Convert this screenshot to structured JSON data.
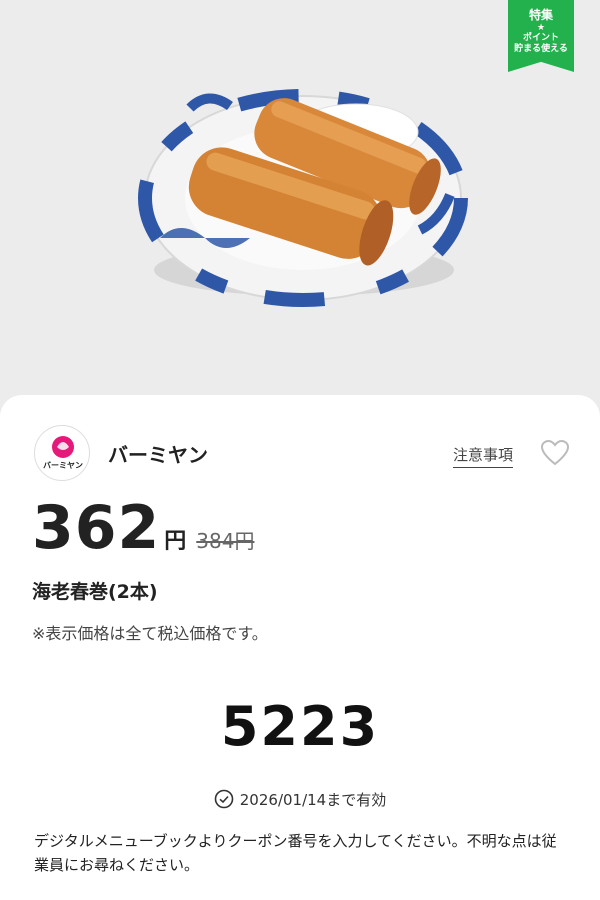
{
  "badge": {
    "line1": "特集",
    "star": "★",
    "line2": "ポイント",
    "line3": "貯まる使える"
  },
  "shop": {
    "name": "バーミヤン",
    "logo_text": "バーミヤン"
  },
  "notes_link": "注意事項",
  "price": {
    "current": "362",
    "unit": "円",
    "original": "384円"
  },
  "item_name": "海老春巻(2本)",
  "tax_note": "※表示価格は全て税込価格です。",
  "coupon_code": "5223",
  "validity": "2026/01/14まで有効",
  "instructions": "デジタルメニューブックよりクーポン番号を入力してください。不明な点は従業員にお尋ねください。",
  "colors": {
    "badge_green": "#22b14c",
    "logo_pink": "#e5197a",
    "plate_blue": "#2f57a8",
    "spring_roll": "#d9883a"
  }
}
